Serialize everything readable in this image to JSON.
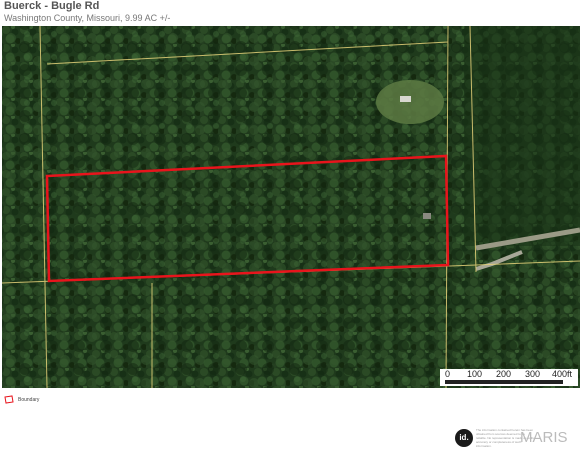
{
  "header": {
    "title": "Buerck - Bugle Rd",
    "subtitle": "Washington County, Missouri, 9.99 AC +/-"
  },
  "map": {
    "boundary_color": "#e8141c",
    "parcel_line_color": "#e6d27a",
    "forest_color": "#1f3a1c"
  },
  "scale": {
    "labels": [
      "0",
      "100",
      "200",
      "300",
      "400ft"
    ]
  },
  "legend": {
    "label": "Boundary",
    "icon": "boundary-outline-icon"
  },
  "footer": {
    "badge_text": "id.",
    "disclaimer": "The information contained herein has been obtained from sources deemed to be reliable. No representation is made as to the accuracy or completeness of such information.",
    "watermark": "MARIS"
  }
}
